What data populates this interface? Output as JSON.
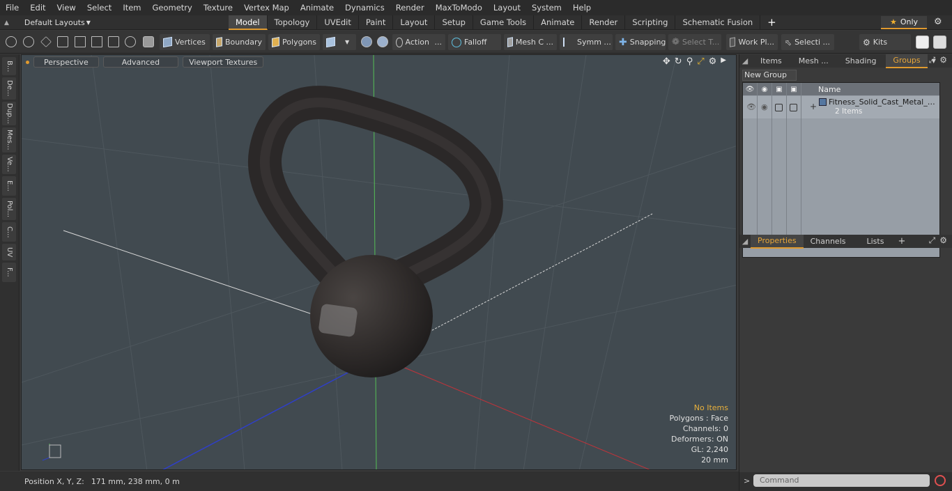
{
  "menu": [
    "File",
    "Edit",
    "View",
    "Select",
    "Item",
    "Geometry",
    "Texture",
    "Vertex Map",
    "Animate",
    "Dynamics",
    "Render",
    "MaxToModo",
    "Layout",
    "System",
    "Help"
  ],
  "layouts": {
    "label": "Default Layouts"
  },
  "tabs": [
    "Model",
    "Topology",
    "UVEdit",
    "Paint",
    "Layout",
    "Setup",
    "Game Tools",
    "Animate",
    "Render",
    "Scripting",
    "Schematic Fusion"
  ],
  "only_label": "Only",
  "toolbar": {
    "vertices": "Vertices",
    "boundary": "Boundary",
    "polygons": "Polygons",
    "action": "Action",
    "falloff": "Falloff",
    "mesh": "Mesh C ...",
    "symm": "Symm ...",
    "snapping": "Snapping",
    "select_t": "Select T...",
    "work_pl": "Work Pl...",
    "selecti": "Selecti ...",
    "kits": "Kits"
  },
  "leftstrip": [
    "B...",
    "De...",
    "Dup...",
    "Mes...",
    "Ve...",
    "E...",
    "Pol...",
    "C...",
    "UV",
    "F..."
  ],
  "viewport": {
    "perspective": "Perspective",
    "advanced": "Advanced",
    "textures": "Viewport Textures",
    "stats": {
      "no_items": "No Items",
      "polygons": "Polygons : Face",
      "channels": "Channels: 0",
      "deformers": "Deformers: ON",
      "gl": "GL: 2,240",
      "scale": "20 mm"
    }
  },
  "status": {
    "position_label": "Position X, Y, Z:",
    "position_value": "171 mm, 238 mm, 0 m"
  },
  "panel_top": {
    "tabs": [
      "Items",
      "Mesh ...",
      "Shading",
      "Groups"
    ],
    "active": 3
  },
  "groups": {
    "new_group": "New Group",
    "name_header": "Name",
    "item_name": "Fitness_Solid_Cast_Metal_Ket...",
    "item_count": "2 Items"
  },
  "panel_bottom": {
    "tabs": [
      "Properties",
      "Channels",
      "Lists"
    ],
    "active": 0
  },
  "command": {
    "placeholder": "Command"
  },
  "colors": {
    "accent": "#e09a2e",
    "viewport_bg": "#414a50",
    "axis_x": "#c0333a",
    "axis_y": "#55c055",
    "axis_z": "#2f3fc8"
  }
}
